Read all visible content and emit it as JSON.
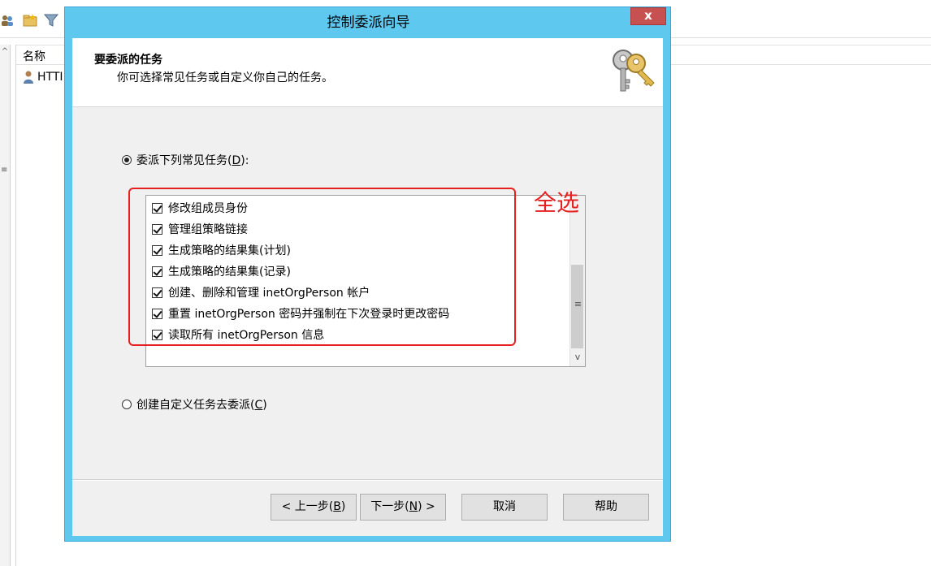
{
  "background": {
    "list_column_name": "名称",
    "list_rows": [
      {
        "label": "HTTI"
      }
    ]
  },
  "dialog": {
    "title": "控制委派向导",
    "close_label": "x",
    "header": {
      "title": "要委派的任务",
      "subtitle": "你可选择常见任务或自定义你自己的任务。"
    },
    "options": {
      "common": {
        "label": "委派下列常见任务(",
        "accel": "D",
        "suffix": "):",
        "selected": true
      },
      "custom": {
        "label": "创建自定义任务去委派(",
        "accel": "C",
        "suffix": ")",
        "selected": false
      }
    },
    "tasks": [
      {
        "label": "修改组成员身份",
        "checked": true
      },
      {
        "label": "管理组策略链接",
        "checked": true
      },
      {
        "label": "生成策略的结果集(计划)",
        "checked": true
      },
      {
        "label": "生成策略的结果集(记录)",
        "checked": true
      },
      {
        "label": "创建、删除和管理 inetOrgPerson 帐户",
        "checked": true
      },
      {
        "label": "重置 inetOrgPerson 密码并强制在下次登录时更改密码",
        "checked": true
      },
      {
        "label": "读取所有 inetOrgPerson 信息",
        "checked": true
      }
    ],
    "buttons": {
      "back": {
        "prefix": "< 上一步(",
        "accel": "B",
        "suffix": ")"
      },
      "next": {
        "prefix": "下一步(",
        "accel": "N",
        "suffix": ") >"
      },
      "cancel": "取消",
      "help": "帮助"
    }
  },
  "annotation": {
    "text": "全选",
    "color": "#e62020"
  },
  "colors": {
    "title_bar": "#5fc8ef",
    "close_button": "#c75050"
  }
}
